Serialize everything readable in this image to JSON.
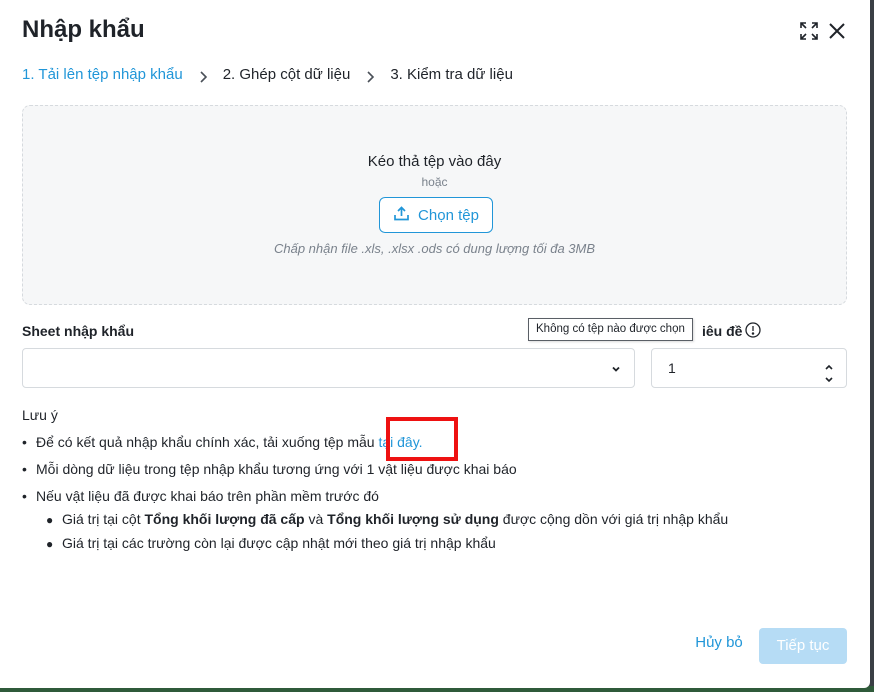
{
  "dialog": {
    "title": "Nhập khẩu",
    "expand_icon": "expand-icon",
    "close_icon": "close-icon"
  },
  "steps": [
    {
      "label": "1. Tải lên tệp nhập khẩu",
      "active": true
    },
    {
      "label": "2. Ghép cột dữ liệu",
      "active": false
    },
    {
      "label": "3. Kiểm tra dữ liệu",
      "active": false
    }
  ],
  "dropzone": {
    "title": "Kéo thả tệp vào đây",
    "or": "hoặc",
    "button_label": "Chọn tệp",
    "button_icon": "upload-icon",
    "hint": "Chấp nhận file .xls, .xlsx .ods có dung lượng tối đa 3MB"
  },
  "sheet": {
    "label": "Sheet nhập khẩu",
    "value": ""
  },
  "header_row": {
    "label_visible": "iêu đề",
    "value": "1"
  },
  "tooltip": "Không có tệp nào được chọn",
  "notes": {
    "title": "Lưu ý",
    "item1_text": "Để có kết quả nhập khẩu chính xác, tải xuống tệp mẫu",
    "item1_link": "tại đây.",
    "item2": "Mỗi dòng dữ liệu trong tệp nhập khẩu tương ứng với 1 vật liệu được khai báo",
    "item3": "Nếu vật liệu đã được khai báo trên phần mềm trước đó",
    "sub1_a": "Giá trị tại cột ",
    "sub1_b": "Tổng khối lượng đã cấp",
    "sub1_c": " và ",
    "sub1_d": "Tổng khối lượng sử dụng",
    "sub1_e": " được cộng dồn với giá trị nhập khẩu",
    "sub2": "Giá trị tại các trường còn lại được cập nhật mới theo giá trị nhập khẩu"
  },
  "footer": {
    "cancel_label": "Hủy bỏ",
    "next_label": "Tiếp tục"
  },
  "colors": {
    "accent": "#2196d8",
    "disabled_button": "#b6dcf5",
    "highlight_box": "#ee1111"
  }
}
